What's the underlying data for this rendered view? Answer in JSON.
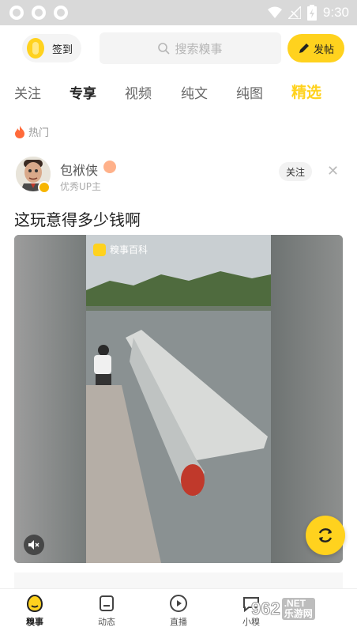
{
  "status_bar": {
    "time": "9:30"
  },
  "header": {
    "checkin_label": "签到",
    "search_placeholder": "搜索糗事",
    "post_label": "发帖"
  },
  "tabs": [
    {
      "label": "关注"
    },
    {
      "label": "专享"
    },
    {
      "label": "视频"
    },
    {
      "label": "纯文"
    },
    {
      "label": "纯图"
    },
    {
      "label": "精选"
    }
  ],
  "section": {
    "hot_label": "热门"
  },
  "post": {
    "author_name": "包袱侠",
    "author_subtitle": "优秀UP主",
    "follow_label": "关注",
    "title": "这玩意得多少钱啊",
    "video_watermark": "糗事百科"
  },
  "bottom_nav": [
    {
      "label": "糗事"
    },
    {
      "label": "动态"
    },
    {
      "label": "直播"
    },
    {
      "label": "小糗"
    }
  ],
  "watermark_logo": {
    "number": "962",
    "line1": ".NET",
    "line2": "乐游网"
  },
  "colors": {
    "accent": "#ffd21e",
    "status_bar": "#d9d9d9"
  }
}
